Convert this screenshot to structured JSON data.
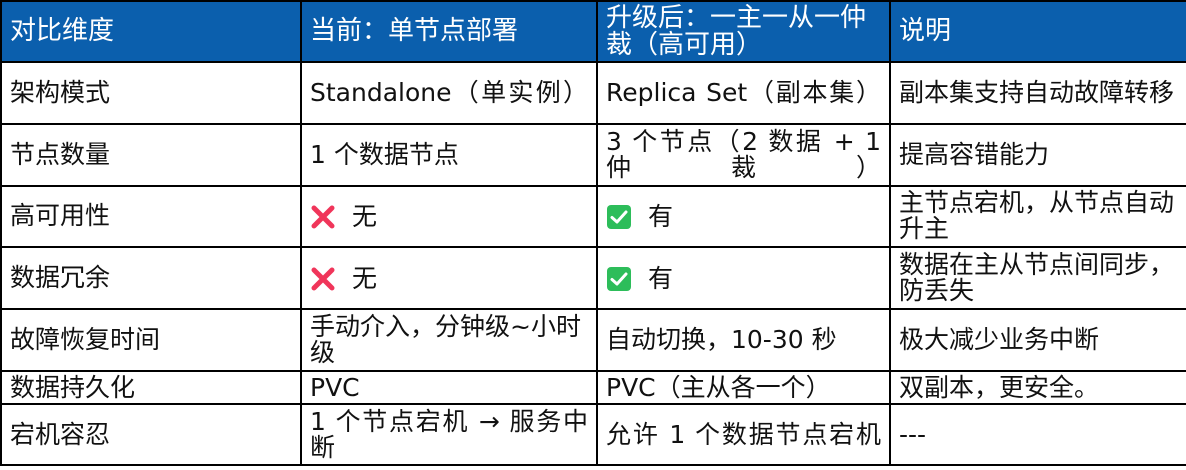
{
  "table": {
    "headers": [
      "对比维度",
      "当前：单节点部署",
      "升级后：一主一从一仲裁（高可用）",
      "说明"
    ],
    "rows": [
      {
        "dimension": "架构模式",
        "current": "Standalone（单实例）",
        "upgraded": "Replica Set（副本集）",
        "note": "副本集支持自动故障转移"
      },
      {
        "dimension": "节点数量",
        "current": "1 个数据节点",
        "upgraded": "3 个节点（2 数据 + 1 仲裁）",
        "note": "提高容错能力"
      },
      {
        "dimension": "高可用性",
        "current": "无",
        "current_icon": "red-x-icon",
        "upgraded": "有",
        "upgraded_icon": "green-check-icon",
        "note": "主节点宕机，从节点自动升主"
      },
      {
        "dimension": "数据冗余",
        "current": "无",
        "current_icon": "red-x-icon",
        "upgraded": "有",
        "upgraded_icon": "green-check-icon",
        "note": "数据在主从节点间同步，防丢失"
      },
      {
        "dimension": "故障恢复时间",
        "current": "手动介入，分钟级~小时级",
        "upgraded": "自动切换，10-30 秒",
        "note": "极大减少业务中断"
      },
      {
        "dimension": "数据持久化",
        "current": "PVC",
        "upgraded": "PVC（主从各一个）",
        "note": "双副本，更安全。"
      },
      {
        "dimension": "宕机容忍",
        "current": "1 个节点宕机 → 服务中断",
        "upgraded": "允许 1 个数据节点宕机",
        "note": "---"
      }
    ]
  },
  "colors": {
    "header_bg": "#0b5fad",
    "header_text": "#ffffff",
    "border": "#000000",
    "x_icon": "#f0355a",
    "check_icon": "#2dbd5a"
  }
}
